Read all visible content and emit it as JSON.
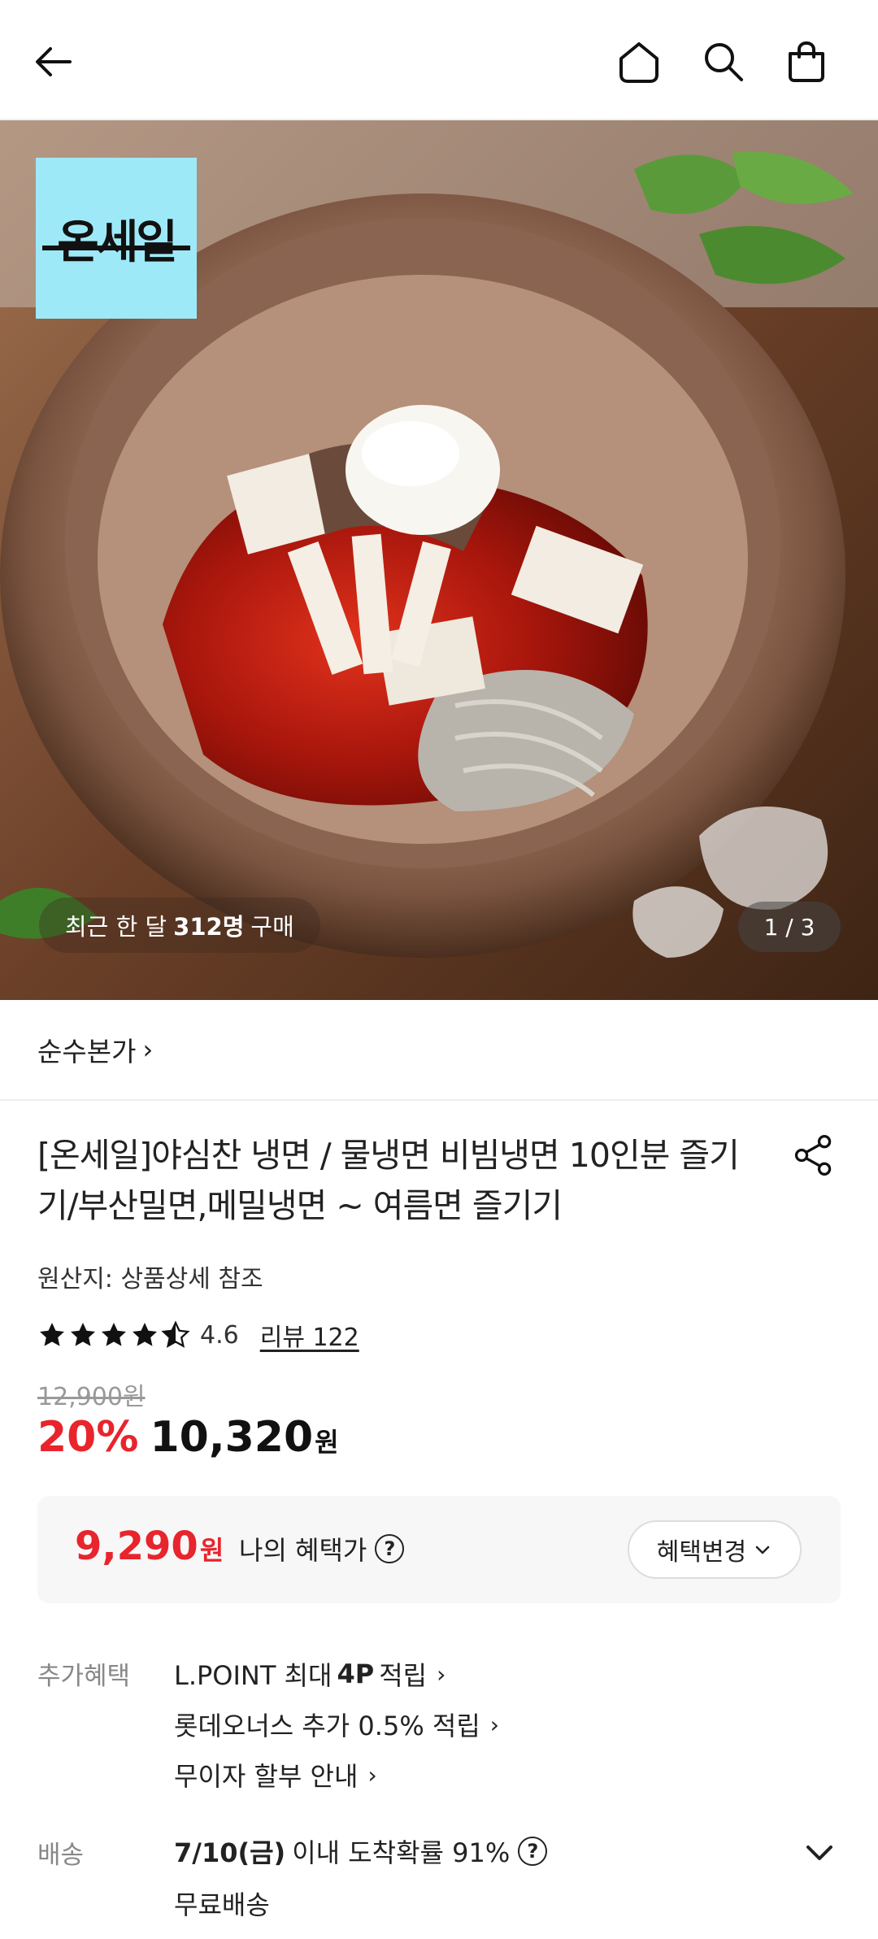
{
  "store": {
    "name": "순수본가"
  },
  "hero": {
    "logo_text": "온세일",
    "purchase_prefix": "최근 한 달",
    "purchase_count": "312명",
    "purchase_suffix": "구매",
    "page_indicator": "1 / 3"
  },
  "product": {
    "title": "[온세일]야심찬 냉면 / 물냉면 비빔냉면 10인분 즐기기/부산밀면,메밀냉면 ~ 여름면 즐기기",
    "origin": "원산지: 상품상세 참조",
    "rating": "4.6",
    "rating_stars": 4.6,
    "review_link": "리뷰 122",
    "original_price": "12,900원",
    "discount": "20%",
    "sale_price": "10,320",
    "sale_unit": "원"
  },
  "benefit": {
    "price": "9,290",
    "unit": "원",
    "label": "나의 혜택가",
    "help": "?",
    "change_button": "혜택변경"
  },
  "extra_benefits": {
    "label": "추가혜택",
    "lpoint_prefix": "L.POINT 최대",
    "lpoint_value": "4P",
    "lpoint_suffix": "적립",
    "lotte_plus": "롯데오너스 추가 0.5% 적립",
    "installment": "무이자 할부 안내"
  },
  "delivery": {
    "label": "배송",
    "date": "7/10(금)",
    "text": "이내 도착확률 91%",
    "help": "?",
    "free": "무료배송"
  },
  "colors": {
    "accent_red": "#e8242c",
    "logo_bg": "#9ee9f7"
  }
}
